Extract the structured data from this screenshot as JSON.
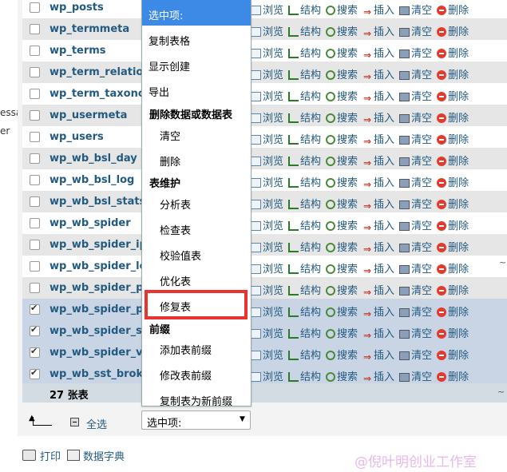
{
  "left_fragments": [
    "essa",
    "er"
  ],
  "tables": [
    {
      "name": "wp_posts",
      "checked": false
    },
    {
      "name": "wp_termmeta",
      "checked": false
    },
    {
      "name": "wp_terms",
      "checked": false
    },
    {
      "name": "wp_term_relationships",
      "checked": false
    },
    {
      "name": "wp_term_taxonomy",
      "checked": false
    },
    {
      "name": "wp_usermeta",
      "checked": false
    },
    {
      "name": "wp_users",
      "checked": false
    },
    {
      "name": "wp_wb_bsl_day",
      "checked": false
    },
    {
      "name": "wp_wb_bsl_log",
      "checked": false
    },
    {
      "name": "wp_wb_bsl_stats",
      "checked": false
    },
    {
      "name": "wp_wb_spider",
      "checked": false
    },
    {
      "name": "wp_wb_spider_ip",
      "checked": false
    },
    {
      "name": "wp_wb_spider_log",
      "checked": false
    },
    {
      "name": "wp_wb_spider_po",
      "checked": false
    },
    {
      "name": "wp_wb_spider_po",
      "checked": true
    },
    {
      "name": "wp_wb_spider_sum",
      "checked": true
    },
    {
      "name": "wp_wb_spider_vis",
      "checked": true
    },
    {
      "name": "wp_wb_sst_broke",
      "checked": true
    }
  ],
  "actions": {
    "browse": "浏览",
    "structure": "结构",
    "search": "搜索",
    "insert": "插入",
    "empty": "清空",
    "drop": "删除"
  },
  "total": "27 张表",
  "bottom": {
    "select_all": "全选",
    "with_selected": "选中项:"
  },
  "footer": {
    "print": "打印",
    "data_dict": "数据字典"
  },
  "dropdown": {
    "header": "选中项:",
    "items": {
      "copy_table": "复制表格",
      "show_create": "显示创建",
      "export": "导出",
      "group_delete": "删除数据或数据表",
      "empty": "清空",
      "drop": "删除",
      "group_maintain": "表维护",
      "analyze": "分析表",
      "check": "检查表",
      "checksum": "校验值表",
      "optimize": "优化表",
      "repair": "修复表",
      "group_prefix": "前缀",
      "add_prefix": "添加表前缀",
      "change_prefix": "修改表前缀",
      "copy_prefix": "复制表为新前缀"
    }
  },
  "right_fragments": [
    "~",
    "~"
  ],
  "watermark": "@倪叶明创业工作室",
  "colors": {
    "link": "#235a81",
    "dropdown_header": "#3c8ae6",
    "highlight_box": "#e8342f",
    "selected_row": "#c9d5e4"
  }
}
